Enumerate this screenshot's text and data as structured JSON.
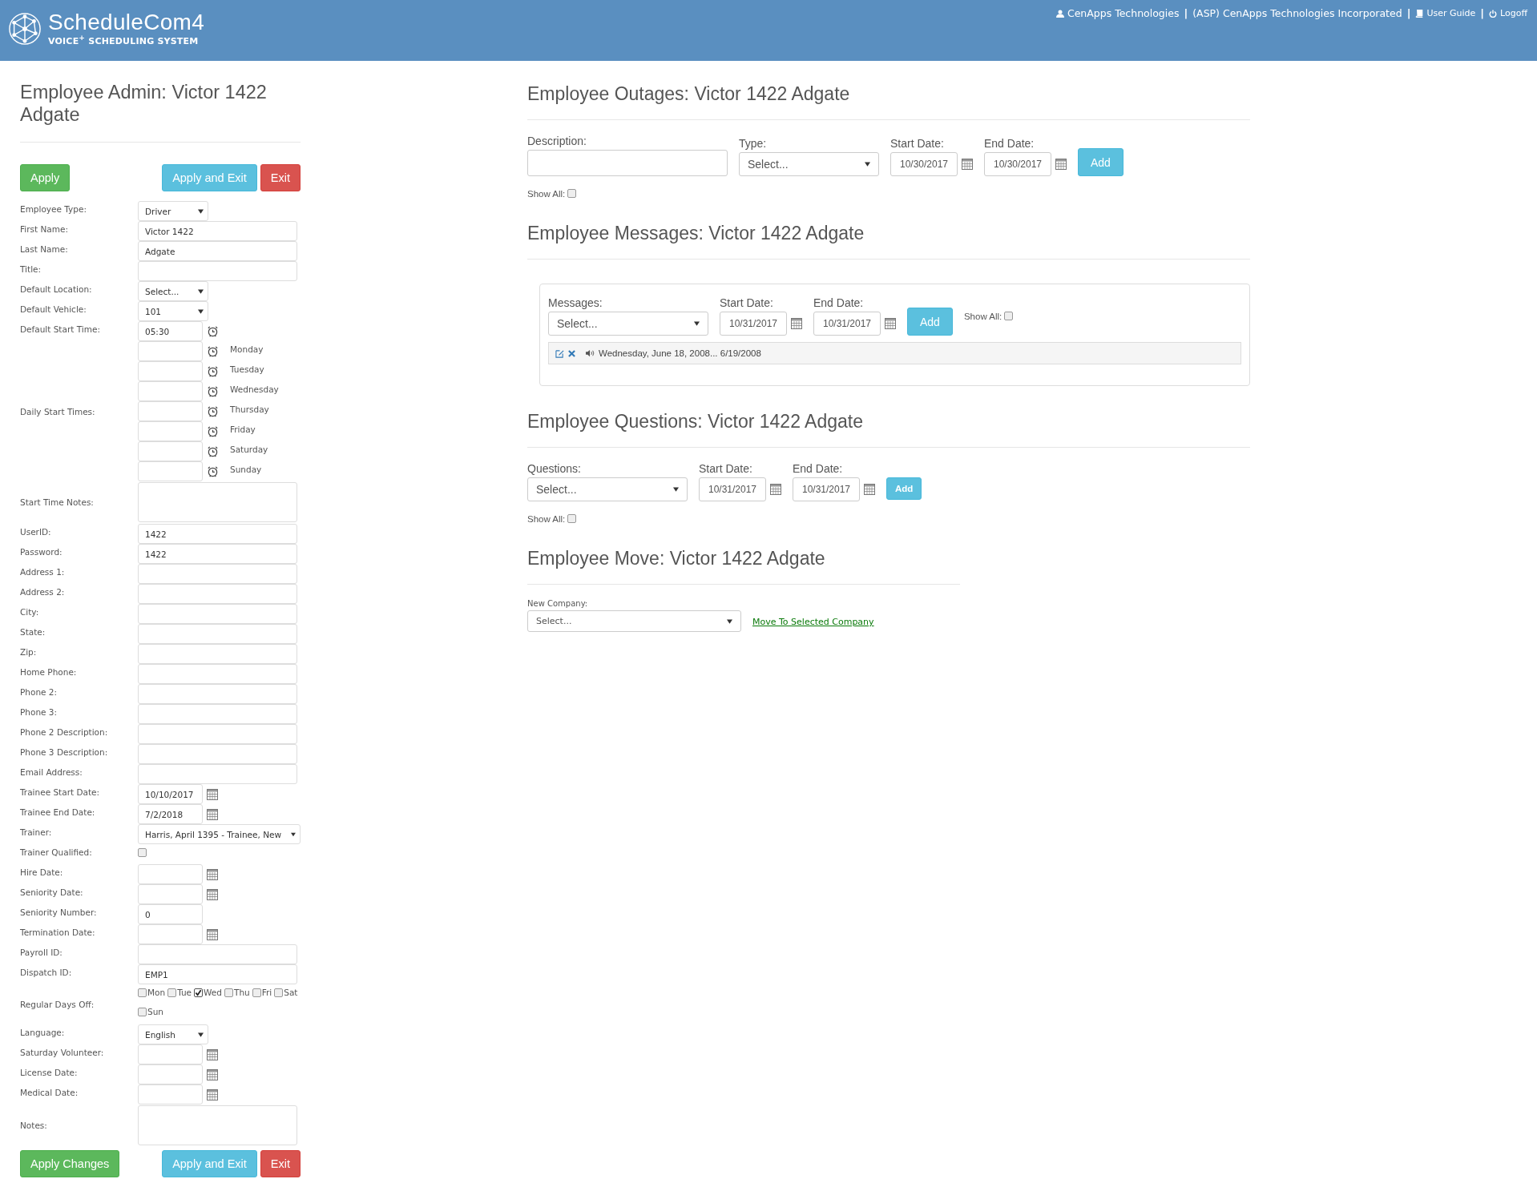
{
  "header": {
    "logo_title": "ScheduleCom4",
    "logo_subtitle": "VOICE$^{+}$ SCHEDULING SYSTEM",
    "nav": [
      {
        "kind": "user",
        "label": "CenApps Technologies"
      },
      {
        "kind": "separator",
        "label": "|"
      },
      {
        "kind": "text",
        "label": "(ASP) CenApps Technologies Incorporated"
      },
      {
        "kind": "separator",
        "label": "|"
      },
      {
        "kind": "guide",
        "label": "User Guide"
      },
      {
        "kind": "separator",
        "label": "|"
      },
      {
        "kind": "logoff",
        "label": "Logoff"
      }
    ]
  },
  "admin": {
    "title": "Employee Admin: Victor 1422 Adgate",
    "top_buttons": [
      {
        "kind": "success",
        "label": "Apply"
      },
      {
        "kind": "info",
        "label": "Apply and Exit"
      },
      {
        "kind": "danger",
        "label": "Exit"
      }
    ],
    "fields": [
      {
        "kind": "select",
        "label": "Employee Type:",
        "value": "Driver"
      },
      {
        "kind": "text",
        "label": "First Name:",
        "value": "Victor 1422"
      },
      {
        "kind": "text",
        "label": "Last Name:",
        "value": "Adgate"
      },
      {
        "kind": "text",
        "label": "Title:"
      },
      {
        "kind": "select",
        "label": "Default Location:",
        "value": "Select..."
      },
      {
        "kind": "select",
        "label": "Default Vehicle:",
        "value": "101"
      },
      {
        "kind": "time",
        "label": "Default Start Time:",
        "value": "05:30"
      },
      {
        "kind": "daily",
        "label": "Daily Start Times:",
        "days": [
          "Monday",
          "Tuesday",
          "Wednesday",
          "Thursday",
          "Friday",
          "Saturday",
          "Sunday"
        ]
      },
      {
        "kind": "textarea",
        "label": "Start Time Notes:"
      },
      {
        "kind": "text",
        "label": "UserID:",
        "value": "1422"
      },
      {
        "kind": "text",
        "label": "Password:",
        "value": "1422"
      },
      {
        "kind": "text",
        "label": "Address 1:"
      },
      {
        "kind": "text",
        "label": "Address 2:"
      },
      {
        "kind": "text",
        "label": "City:"
      },
      {
        "kind": "text",
        "label": "State:"
      },
      {
        "kind": "text",
        "label": "Zip:"
      },
      {
        "kind": "text",
        "label": "Home Phone:"
      },
      {
        "kind": "text",
        "label": "Phone 2:"
      },
      {
        "kind": "text",
        "label": "Phone 3:"
      },
      {
        "kind": "text",
        "label": "Phone 2 Description:"
      },
      {
        "kind": "text",
        "label": "Phone 3 Description:"
      },
      {
        "kind": "text",
        "label": "Email Address:"
      },
      {
        "kind": "date",
        "label": "Trainee Start Date:",
        "value": "10/10/2017"
      },
      {
        "kind": "date",
        "label": "Trainee End Date:",
        "value": "7/2/2018"
      },
      {
        "kind": "select",
        "label": "Trainer:",
        "value": "Harris, April 1395 - Trainee, New"
      },
      {
        "kind": "checkbox",
        "label": "Trainer Qualified:",
        "checked": false
      },
      {
        "kind": "date",
        "label": "Hire Date:"
      },
      {
        "kind": "date",
        "label": "Seniority Date:"
      },
      {
        "kind": "short",
        "label": "Seniority Number:",
        "value": "0"
      },
      {
        "kind": "date",
        "label": "Termination Date:"
      },
      {
        "kind": "text",
        "label": "Payroll ID:"
      },
      {
        "kind": "text",
        "label": "Dispatch ID:",
        "value": "EMP1"
      },
      {
        "kind": "days",
        "label": "Regular Days Off:",
        "days": [
          {
            "label": "Mon",
            "checked": false
          },
          {
            "label": "Tue",
            "checked": false
          },
          {
            "label": "Wed",
            "checked": true
          },
          {
            "label": "Thu",
            "checked": false
          },
          {
            "label": "Fri",
            "checked": false
          },
          {
            "label": "Sat",
            "checked": false
          },
          {
            "label": "Sun",
            "checked": false
          }
        ]
      },
      {
        "kind": "select",
        "label": "Language:",
        "value": "English"
      },
      {
        "kind": "date",
        "label": "Saturday Volunteer:"
      },
      {
        "kind": "date",
        "label": "License Date:"
      },
      {
        "kind": "date",
        "label": "Medical Date:"
      },
      {
        "kind": "textarea",
        "label": "Notes:"
      }
    ],
    "bottom_buttons": [
      {
        "kind": "success",
        "label": "Apply Changes"
      },
      {
        "kind": "info",
        "label": "Apply and Exit"
      },
      {
        "kind": "danger",
        "label": "Exit"
      }
    ]
  },
  "sections": [
    {
      "kind": "outages",
      "title": "Employee Outages: Victor 1422 Adgate",
      "controls": [
        {
          "kind": "text",
          "label": "Description:"
        },
        {
          "kind": "select",
          "label": "Type:",
          "value": "Select..."
        },
        {
          "kind": "date",
          "label": "Start Date:",
          "value": "10/30/2017"
        },
        {
          "kind": "date",
          "label": "End Date:",
          "value": "10/30/2017"
        },
        {
          "kind": "button",
          "label": "Add"
        }
      ],
      "show_all": {
        "label": "Show All:",
        "checked": false
      }
    },
    {
      "kind": "messages",
      "title": "Employee Messages: Victor 1422 Adgate",
      "controls": [
        {
          "kind": "select",
          "label": "Messages:",
          "value": "Select..."
        },
        {
          "kind": "date",
          "label": "Start Date:",
          "value": "10/31/2017"
        },
        {
          "kind": "date",
          "label": "End Date:",
          "value": "10/31/2017"
        },
        {
          "kind": "button",
          "label": "Add"
        }
      ],
      "show_all": {
        "label": "Show All:",
        "checked": false
      },
      "entries": [
        {
          "text": "Wednesday, June 18, 2008... 6/19/2008"
        }
      ]
    },
    {
      "kind": "questions",
      "title": "Employee Questions: Victor 1422 Adgate",
      "controls": [
        {
          "kind": "select",
          "label": "Questions:",
          "value": "Select..."
        },
        {
          "kind": "date",
          "label": "Start Date:",
          "value": "10/31/2017"
        },
        {
          "kind": "date",
          "label": "End Date:",
          "value": "10/31/2017"
        },
        {
          "kind": "button",
          "label": "Add"
        }
      ],
      "show_all": {
        "label": "Show All:",
        "checked": false
      }
    },
    {
      "kind": "move",
      "title": "Employee Move: Victor 1422 Adgate",
      "controls": [
        {
          "kind": "select",
          "label": "New Company:",
          "value": "Select..."
        },
        {
          "kind": "link",
          "label": "Move To Selected Company"
        }
      ]
    }
  ]
}
